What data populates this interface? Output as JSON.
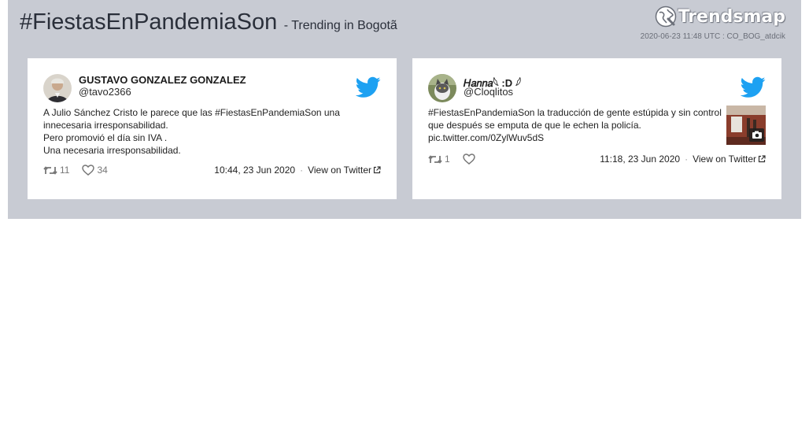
{
  "header": {
    "hashtag": "#FiestasEnPandemiaSon",
    "subtitle": "- Trending in Bogotã",
    "brand": "Trendsmap",
    "meta": "2020-06-23 11:48 UTC : CO_BOG_atdcik"
  },
  "tweets": [
    {
      "author_name": "GUSTAVO GONZALEZ GONZALEZ",
      "handle": "@tavo2366",
      "text_lines": [
        "A Julio Sánchez Cristo le parece que las #FiestasEnPandemiaSon una",
        "innecesaria irresponsabilidad.",
        "Pero promovió el día sin IVA .",
        "Una necesaria irresponsabilidad."
      ],
      "retweets": "11",
      "likes": "34",
      "date": "10:44, 23 Jun 2020",
      "separator": "·",
      "view_label": "View on Twitter"
    },
    {
      "author_name": "𝐻𝑎𝑛𝑛𝑎𓆩 :D 𓆪",
      "handle": "@Cloqlitos",
      "text_lines": [
        "#FiestasEnPandemiaSon la traducción de gente estúpida y sin control",
        "que después se emputa de que le echen la policía.",
        "pic.twitter.com/0ZylWuv5dS"
      ],
      "retweets": "1",
      "likes": "",
      "date": "11:18, 23 Jun 2020",
      "separator": "·",
      "view_label": "View on Twitter"
    }
  ],
  "icons": {
    "brand": "trendsmap-globe-icon",
    "bird": "twitter-bird-icon",
    "retweet": "retweet-icon",
    "like": "heart-icon",
    "external": "external-link-icon",
    "camera": "camera-icon"
  },
  "colors": {
    "panel": "#c8cbd3",
    "twitter_blue": "#1da1f2",
    "title": "#2a2f3a"
  }
}
